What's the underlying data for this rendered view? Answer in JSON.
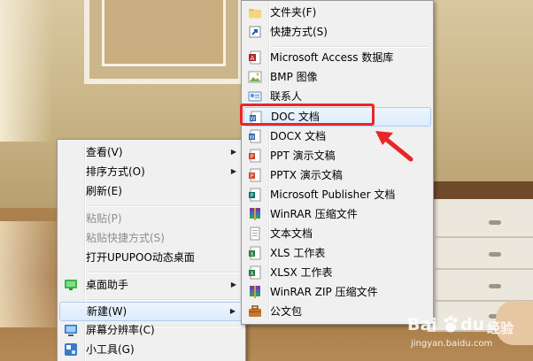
{
  "left_menu": {
    "items": [
      {
        "label": "查看(V)",
        "submenu": true
      },
      {
        "label": "排序方式(O)",
        "submenu": true
      },
      {
        "label": "刷新(E)"
      },
      {
        "label": "粘贴(P)",
        "disabled": true
      },
      {
        "label": "粘贴快捷方式(S)",
        "disabled": true
      },
      {
        "label": "打开UPUPOO动态桌面"
      },
      {
        "label": "桌面助手",
        "submenu": true,
        "icon": "desktop-assistant-icon"
      },
      {
        "label": "新建(W)",
        "submenu": true,
        "highlighted": true
      },
      {
        "label": "屏幕分辨率(C)",
        "icon": "monitor-icon"
      },
      {
        "label": "小工具(G)",
        "icon": "gadgets-icon"
      }
    ]
  },
  "new_submenu": {
    "items": [
      {
        "label": "文件夹(F)",
        "icon": "folder-icon"
      },
      {
        "label": "快捷方式(S)",
        "icon": "shortcut-icon"
      },
      {
        "label": "Microsoft Access 数据库",
        "icon": "access-db-icon"
      },
      {
        "label": "BMP 图像",
        "icon": "bmp-image-icon"
      },
      {
        "label": "联系人",
        "icon": "contact-icon"
      },
      {
        "label": "DOC 文档",
        "icon": "doc-document-icon",
        "highlighted": true
      },
      {
        "label": "DOCX 文档",
        "icon": "docx-document-icon"
      },
      {
        "label": "PPT 演示文稿",
        "icon": "ppt-icon"
      },
      {
        "label": "PPTX 演示文稿",
        "icon": "pptx-icon"
      },
      {
        "label": "Microsoft Publisher 文档",
        "icon": "publisher-icon"
      },
      {
        "label": "WinRAR 压缩文件",
        "icon": "winrar-icon"
      },
      {
        "label": "文本文档",
        "icon": "text-document-icon"
      },
      {
        "label": "XLS 工作表",
        "icon": "xls-icon"
      },
      {
        "label": "XLSX 工作表",
        "icon": "xlsx-icon"
      },
      {
        "label": "WinRAR ZIP 压缩文件",
        "icon": "winrar-zip-icon"
      },
      {
        "label": "公文包",
        "icon": "briefcase-icon"
      }
    ]
  },
  "colors": {
    "highlight_box": "#e8262a",
    "arrow": "#e8262a",
    "menu_bg": "#f0f0f0",
    "hover_bg": "#dcebfc"
  },
  "watermark": {
    "brand": "Bai",
    "brand_suffix": "经验",
    "url": "jingyan.baidu.com"
  }
}
